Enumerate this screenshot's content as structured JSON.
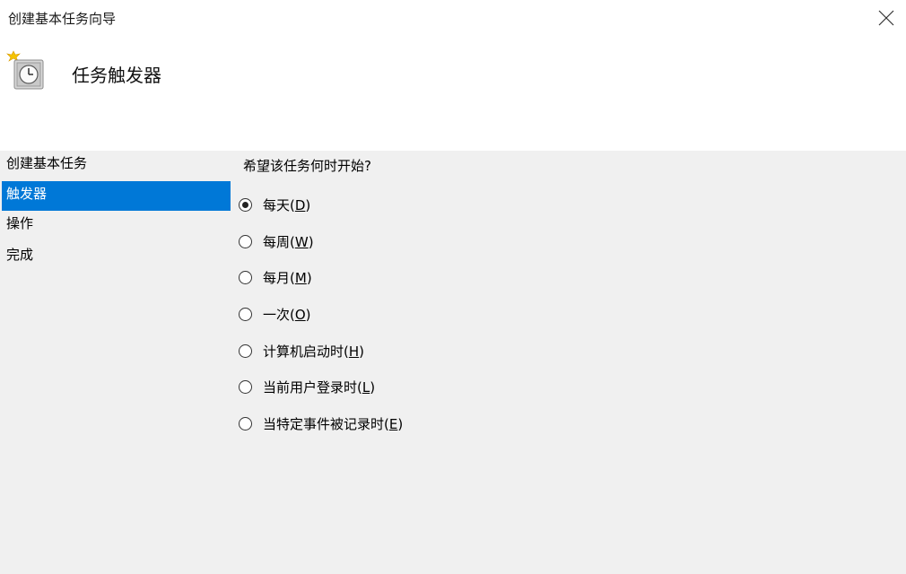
{
  "window": {
    "title": "创建基本任务向导"
  },
  "header": {
    "title": "任务触发器",
    "icon": "scheduled-task-clock-icon"
  },
  "sidebar": {
    "items": [
      {
        "label": "创建基本任务",
        "active": false
      },
      {
        "label": "触发器",
        "active": true
      },
      {
        "label": "操作",
        "active": false
      },
      {
        "label": "完成",
        "active": false
      }
    ]
  },
  "main": {
    "question": "希望该任务何时开始?",
    "options": [
      {
        "label": "每天(",
        "key": "D",
        "suffix": ")",
        "selected": true
      },
      {
        "label": "每周(",
        "key": "W",
        "suffix": ")",
        "selected": false
      },
      {
        "label": "每月(",
        "key": "M",
        "suffix": ")",
        "selected": false
      },
      {
        "label": "一次(",
        "key": "O",
        "suffix": ")",
        "selected": false
      },
      {
        "label": "计算机启动时(",
        "key": "H",
        "suffix": ")",
        "selected": false
      },
      {
        "label": "当前用户登录时(",
        "key": "L",
        "suffix": ")",
        "selected": false
      },
      {
        "label": "当特定事件被记录时(",
        "key": "E",
        "suffix": ")",
        "selected": false
      }
    ]
  },
  "colors": {
    "accent": "#0078d7",
    "content_bg": "#f0f0f0"
  }
}
